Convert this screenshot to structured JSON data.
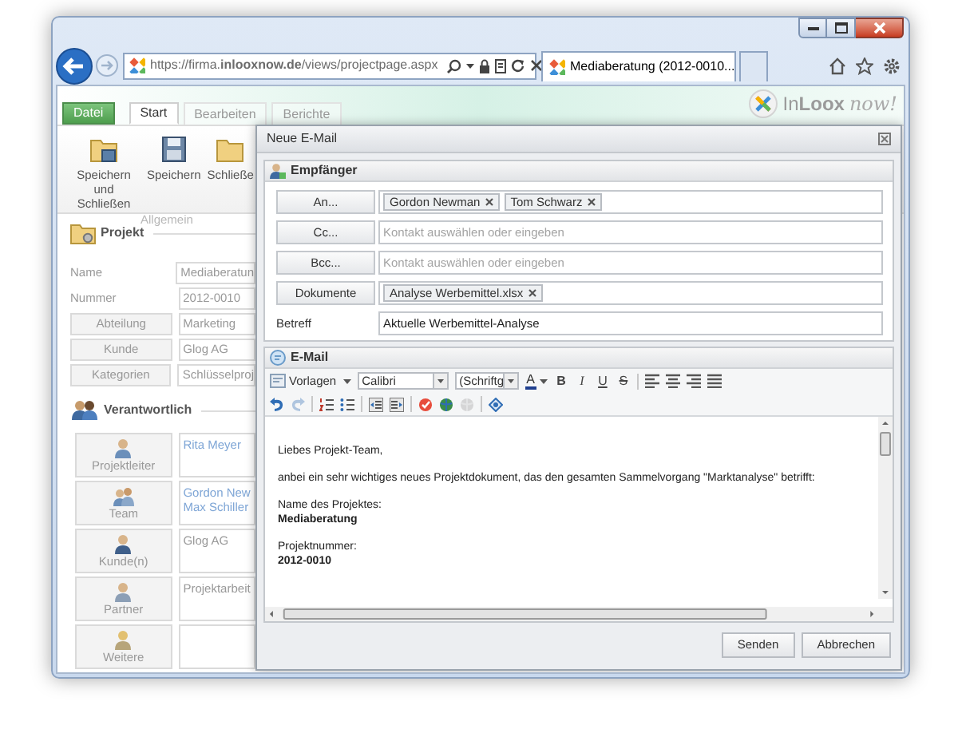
{
  "browser": {
    "address": "https://firma.**inlooxnow.de**/views/projectpage.aspx",
    "tabs": [
      {
        "title": "Mediaberatung (2012-0010...",
        "selected": true
      }
    ]
  },
  "app": {
    "logo": {
      "brand": "In**Loox**",
      "tagline": "now!"
    },
    "ribbon_tabs": [
      {
        "label": "Datei",
        "kind": "file",
        "selected": false
      },
      {
        "label": "Start",
        "kind": "tab",
        "selected": true
      },
      {
        "label": "Bearbeiten",
        "kind": "tab",
        "selected": false
      },
      {
        "label": "Berichte",
        "kind": "tab",
        "selected": false
      }
    ],
    "ribbon_buttons": [
      {
        "label": "Speichern und Schließen",
        "kind": "save-close"
      },
      {
        "label": "Speichern",
        "kind": "save"
      },
      {
        "label": "Schließe",
        "kind": "close"
      }
    ],
    "ribbon_group": "Allgemein"
  },
  "project": {
    "title": "Projekt",
    "fields": [
      {
        "kind": "label",
        "label": "Name",
        "value": "Mediaberatun"
      },
      {
        "kind": "label",
        "label": "Nummer",
        "value": "2012-0010"
      },
      {
        "kind": "button",
        "label": "Abteilung",
        "value": "Marketing"
      },
      {
        "kind": "button",
        "label": "Kunde",
        "value": "Glog AG"
      },
      {
        "kind": "button",
        "label": "Kategorien",
        "value": "Schlüsselproj"
      }
    ]
  },
  "responsible": {
    "title": "Verantwortlich",
    "roles": [
      {
        "label": "Projektleiter",
        "kind": "person",
        "values": [
          {
            "text": "Rita Meyer",
            "link": true
          }
        ]
      },
      {
        "label": "Team",
        "kind": "team",
        "values": [
          {
            "text": "Gordon New",
            "link": true
          },
          {
            "text": "Max Schiller",
            "link": true
          }
        ]
      },
      {
        "label": "Kunde(n)",
        "kind": "customer",
        "values": [
          {
            "text": "Glog AG",
            "link": false
          }
        ]
      },
      {
        "label": "Partner",
        "kind": "partner",
        "values": [
          {
            "text": "Projektarbeit",
            "link": false
          }
        ]
      },
      {
        "label": "Weitere",
        "kind": "other"
      }
    ]
  },
  "dialog": {
    "title": "Neue E-Mail",
    "recipients": {
      "title": "Empfänger",
      "rows": [
        {
          "button": "An...",
          "chips": [
            "Gordon Newman",
            "Tom Schwarz"
          ]
        },
        {
          "button": "Cc...",
          "placeholder": "Kontakt auswählen oder eingeben"
        },
        {
          "button": "Bcc...",
          "placeholder": "Kontakt auswählen oder eingeben"
        },
        {
          "button": "Dokumente",
          "chips": [
            "Analyse Werbemittel.xlsx"
          ]
        }
      ],
      "subject": {
        "label": "Betreff",
        "value": "Aktuelle Werbemittel-Analyse"
      }
    },
    "email": {
      "title": "E-Mail",
      "toolbar_rows": [
        [
          {
            "kind": "templates",
            "label": "Vorlagen"
          },
          {
            "kind": "select",
            "value": "Calibri",
            "wide": true
          },
          {
            "kind": "select",
            "value": "(Schriftg",
            "wide": false
          },
          {
            "kind": "fontcolor",
            "label": "A"
          },
          {
            "kind": "bold",
            "label": "B"
          },
          {
            "kind": "italic",
            "label": "I"
          },
          {
            "kind": "underline",
            "label": "U"
          },
          {
            "kind": "strike",
            "label": "S"
          },
          {
            "kind": "separator"
          },
          {
            "kind": "align-left"
          },
          {
            "kind": "align-center"
          },
          {
            "kind": "align-right"
          },
          {
            "kind": "align-justify"
          }
        ],
        [
          {
            "kind": "undo",
            "disabled": false
          },
          {
            "kind": "redo",
            "disabled": true
          },
          {
            "kind": "separator"
          },
          {
            "kind": "ordered-list",
            "disabled": false
          },
          {
            "kind": "bullet-list",
            "disabled": false
          },
          {
            "kind": "separator"
          },
          {
            "kind": "outdent",
            "disabled": false
          },
          {
            "kind": "indent",
            "disabled": false
          },
          {
            "kind": "separator"
          },
          {
            "kind": "spellcheck",
            "disabled": false
          },
          {
            "kind": "link",
            "disabled": false
          },
          {
            "kind": "unlink",
            "disabled": true
          },
          {
            "kind": "separator"
          },
          {
            "kind": "anchor",
            "disabled": false
          }
        ]
      ],
      "paragraphs": [
        [
          {
            "text": "Liebes Projekt-Team,",
            "bold": false
          }
        ],
        [
          {
            "text": "anbei ein sehr wichtiges neues Projektdokument, das den gesamten Sammelvorgang \"Marktanalyse\" betrifft:",
            "bold": false
          }
        ],
        [
          {
            "text": "Name des Projektes:",
            "bold": false
          },
          {
            "text": "Mediaberatung",
            "bold": true
          }
        ],
        [
          {
            "text": "Projektnummer:",
            "bold": false
          },
          {
            "text": "2012-0010",
            "bold": true
          }
        ]
      ]
    },
    "buttons": [
      "Senden",
      "Abbrechen"
    ]
  }
}
